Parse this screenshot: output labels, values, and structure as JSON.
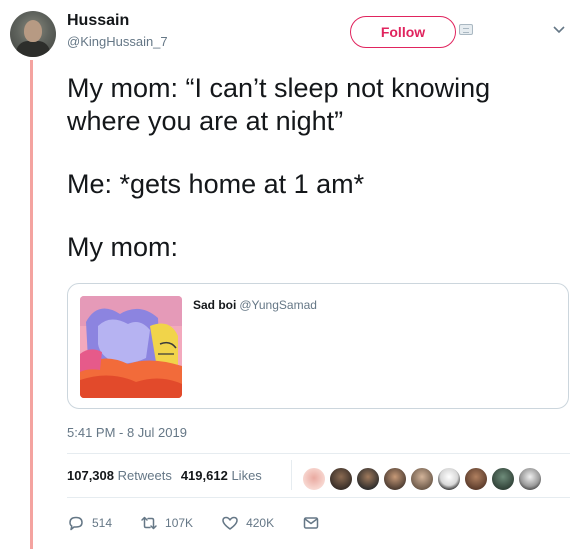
{
  "author": {
    "name": "Hussain",
    "handle": "@KingHussain_7",
    "avatar_icon": "profile-photo"
  },
  "header": {
    "follow_label": "Follow",
    "badge_icon": "sharing-badge-icon",
    "menu_icon": "chevron-down-icon"
  },
  "tweet": {
    "lines": [
      "My mom: “I can’t sleep not knowing where you are at night”",
      "Me: *gets home at 1 am*",
      "My mom:"
    ]
  },
  "quote": {
    "name": "Sad boi",
    "handle": "@YungSamad",
    "image_icon": "simpsons-homer-in-bed-thumbnail"
  },
  "timestamp": "5:41 PM - 8 Jul 2019",
  "stats": {
    "retweets_count": "107,308",
    "retweets_label": "Retweets",
    "likes_count": "419,612",
    "likes_label": "Likes",
    "liker_avatars_count": 9
  },
  "actions": {
    "reply_count": "514",
    "retweet_count": "107K",
    "like_count": "420K",
    "reply_icon": "reply-bubble-icon",
    "retweet_icon": "retweet-icon",
    "like_icon": "heart-icon",
    "message_icon": "envelope-icon"
  },
  "colors": {
    "accent": "#e0245e",
    "thread_line": "#f4a3a0",
    "muted_text": "#657786",
    "border": "#ccd6dd"
  }
}
